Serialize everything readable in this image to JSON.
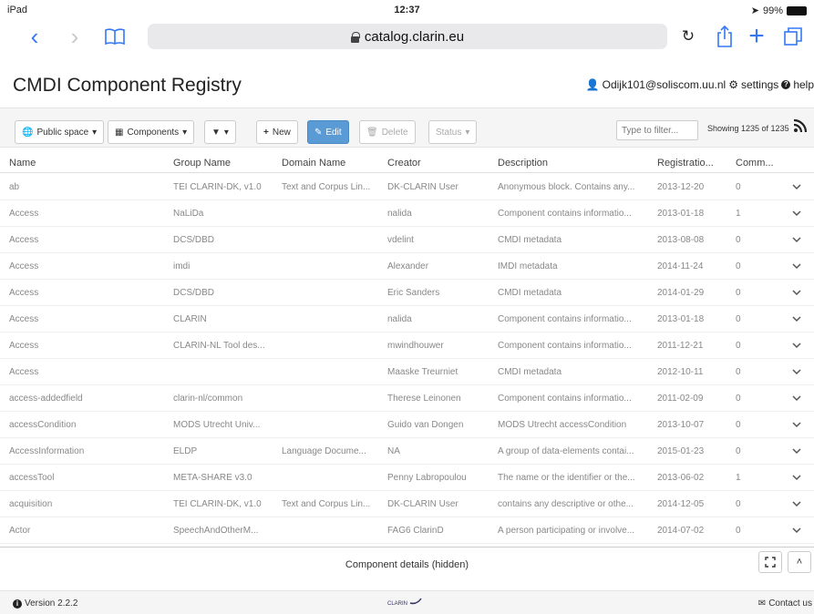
{
  "statusbar": {
    "device": "iPad",
    "time": "12:37",
    "battery": "99%"
  },
  "browser": {
    "url": "catalog.clarin.eu"
  },
  "app": {
    "title": "CMDI Component Registry",
    "user": "Odijk101@soliscom.uu.nl",
    "settings_label": "settings",
    "help_label": "help"
  },
  "toolbar": {
    "space_label": "Public space",
    "type_label": "Components",
    "new_label": "New",
    "edit_label": "Edit",
    "delete_label": "Delete",
    "status_label": "Status",
    "filter_placeholder": "Type to filter...",
    "showing": "Showing 1235 of 1235"
  },
  "table": {
    "headers": {
      "name": "Name",
      "group": "Group Name",
      "domain": "Domain Name",
      "creator": "Creator",
      "description": "Description",
      "registration": "Registratio...",
      "comments": "Comm..."
    },
    "rows": [
      {
        "name": "ab",
        "group": "TEI CLARIN-DK, v1.0",
        "domain": "Text and Corpus Lin...",
        "creator": "DK-CLARIN User",
        "description": "Anonymous block. Contains any...",
        "date": "2013-12-20",
        "comments": "0"
      },
      {
        "name": "Access",
        "group": "NaLiDa",
        "domain": "",
        "creator": "nalida",
        "description": "Component contains informatio...",
        "date": "2013-01-18",
        "comments": "1"
      },
      {
        "name": "Access",
        "group": "DCS/DBD",
        "domain": "",
        "creator": "vdelint",
        "description": "CMDI metadata",
        "date": "2013-08-08",
        "comments": "0"
      },
      {
        "name": "Access",
        "group": "imdi",
        "domain": "",
        "creator": "Alexander",
        "description": "IMDI metadata",
        "date": "2014-11-24",
        "comments": "0"
      },
      {
        "name": "Access",
        "group": "DCS/DBD",
        "domain": "",
        "creator": "Eric Sanders",
        "description": "CMDI metadata",
        "date": "2014-01-29",
        "comments": "0"
      },
      {
        "name": "Access",
        "group": "CLARIN",
        "domain": "",
        "creator": "nalida",
        "description": "Component contains informatio...",
        "date": "2013-01-18",
        "comments": "0"
      },
      {
        "name": "Access",
        "group": "CLARIN-NL Tool des...",
        "domain": "",
        "creator": "mwindhouwer",
        "description": "Component contains informatio...",
        "date": "2011-12-21",
        "comments": "0"
      },
      {
        "name": "Access",
        "group": "",
        "domain": "",
        "creator": "Maaske Treurniet",
        "description": "CMDI metadata",
        "date": "2012-10-11",
        "comments": "0"
      },
      {
        "name": "access-addedfield",
        "group": "clarin-nl/common",
        "domain": "",
        "creator": "Therese Leinonen",
        "description": "Component contains informatio...",
        "date": "2011-02-09",
        "comments": "0"
      },
      {
        "name": "accessCondition",
        "group": "MODS Utrecht Univ...",
        "domain": "",
        "creator": "Guido van Dongen",
        "description": "MODS Utrecht accessCondition",
        "date": "2013-10-07",
        "comments": "0"
      },
      {
        "name": "AccessInformation",
        "group": "ELDP",
        "domain": "Language Docume...",
        "creator": "NA",
        "description": "A group of data-elements contai...",
        "date": "2015-01-23",
        "comments": "0"
      },
      {
        "name": "accessTool",
        "group": "META-SHARE v3.0",
        "domain": "",
        "creator": "Penny Labropoulou",
        "description": "The name or the identifier or the...",
        "date": "2013-06-02",
        "comments": "1"
      },
      {
        "name": "acquisition",
        "group": "TEI CLARIN-DK, v1.0",
        "domain": "Text and Corpus Lin...",
        "creator": "DK-CLARIN User",
        "description": "contains any descriptive or othe...",
        "date": "2014-12-05",
        "comments": "0"
      },
      {
        "name": "Actor",
        "group": "SpeechAndOtherM...",
        "domain": "",
        "creator": "FAG6 ClarinD",
        "description": "A person participating or involve...",
        "date": "2014-07-02",
        "comments": "0"
      }
    ]
  },
  "details": {
    "label": "Component details (hidden)"
  },
  "footer": {
    "version": "Version 2.2.2",
    "logo_text": "CLARIN",
    "contact": "Contact us"
  }
}
